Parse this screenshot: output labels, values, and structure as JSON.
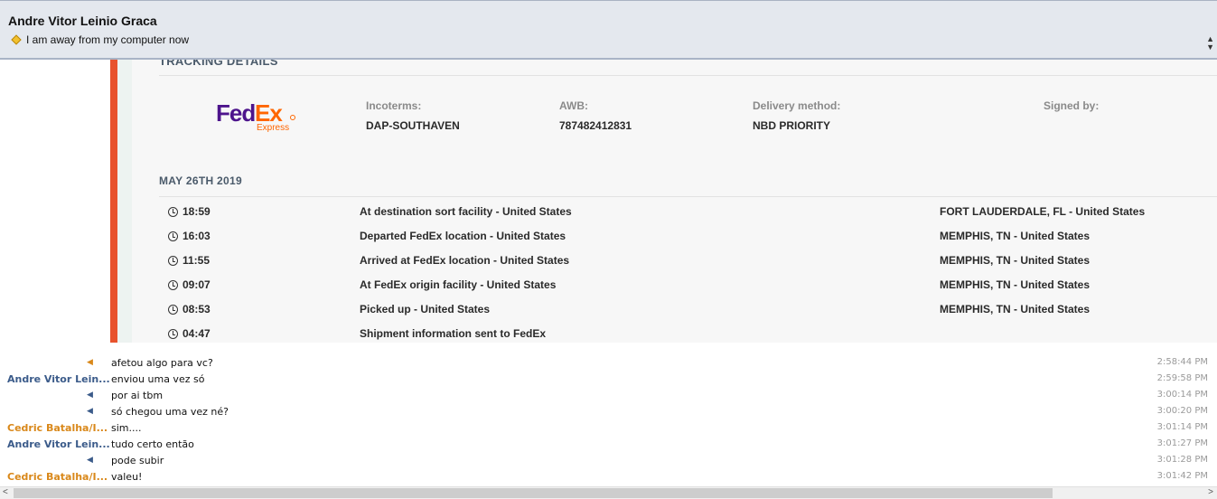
{
  "header": {
    "contact_name": "Andre Vitor Leinio Graca",
    "status_message": "I am away from my computer now"
  },
  "tracking": {
    "title": "TRACKING DETAILS",
    "carrier_logo": {
      "main_left": "Fed",
      "main_right": "Ex",
      "sub": "Express"
    },
    "info": [
      {
        "label": "Incoterms:",
        "value": "DAP-SOUTHAVEN"
      },
      {
        "label": "AWB:",
        "value": "787482412831"
      },
      {
        "label": "Delivery method:",
        "value": "NBD PRIORITY"
      },
      {
        "label": "Signed by:",
        "value": ""
      }
    ],
    "date_heading": "MAY 26TH 2019",
    "events": [
      {
        "time": "18:59",
        "description": "At destination sort facility - United States",
        "location": "FORT LAUDERDALE, FL - United States"
      },
      {
        "time": "16:03",
        "description": "Departed FedEx location - United States",
        "location": "MEMPHIS, TN - United States"
      },
      {
        "time": "11:55",
        "description": "Arrived at FedEx location - United States",
        "location": "MEMPHIS, TN - United States"
      },
      {
        "time": "09:07",
        "description": "At FedEx origin facility - United States",
        "location": "MEMPHIS, TN - United States"
      },
      {
        "time": "08:53",
        "description": "Picked up - United States",
        "location": "MEMPHIS, TN - United States"
      },
      {
        "time": "04:47",
        "description": "Shipment information sent to FedEx",
        "location": ""
      }
    ]
  },
  "chat": {
    "messages": [
      {
        "sender": "",
        "color": "orange",
        "text": "afetou algo para vc?",
        "time": "2:58:44 PM"
      },
      {
        "sender": "Andre Vitor Lein...",
        "color": "blue",
        "text": "enviou uma vez só",
        "time": "2:59:58 PM"
      },
      {
        "sender": "",
        "color": "blue",
        "text": "por ai tbm",
        "time": "3:00:14 PM"
      },
      {
        "sender": "",
        "color": "blue",
        "text": "só chegou uma vez né?",
        "time": "3:00:20 PM"
      },
      {
        "sender": "Cedric Batalha/I...",
        "color": "orange",
        "text": "sim....",
        "time": "3:01:14 PM"
      },
      {
        "sender": "Andre Vitor Lein...",
        "color": "blue",
        "text": "tudo certo então",
        "time": "3:01:27 PM"
      },
      {
        "sender": "",
        "color": "blue",
        "text": "pode subir",
        "time": "3:01:28 PM"
      },
      {
        "sender": "Cedric Batalha/I...",
        "color": "orange",
        "text": "valeu!",
        "time": "3:01:42 PM"
      }
    ]
  },
  "colors": {
    "accent_red": "#e8522d",
    "sender_blue": "#3b5b8a",
    "sender_orange": "#d9881a",
    "status_yellow": "#f2c12e",
    "fedex_purple": "#4d148c",
    "fedex_orange": "#ff6600"
  },
  "icons": {
    "status": "diamond-status-icon",
    "event_time": "clock-icon",
    "continuation": "triangle-left-icon"
  }
}
